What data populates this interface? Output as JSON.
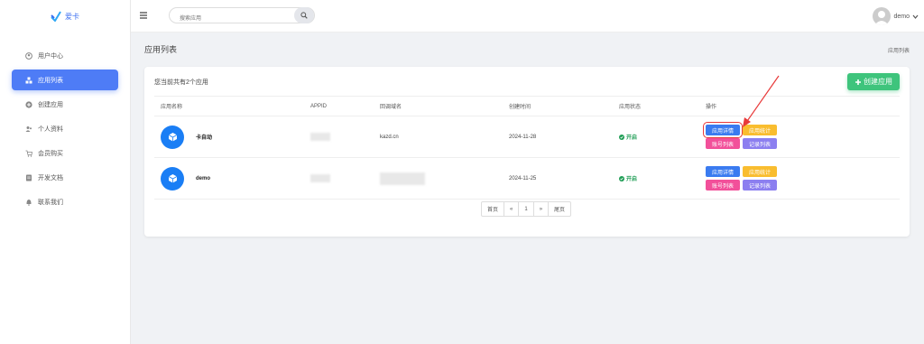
{
  "brand": {
    "name": "爱卡",
    "color": "#3b6ef0"
  },
  "sidebar": {
    "items": [
      {
        "label": "用户中心",
        "icon": "user-circle-icon",
        "active": false
      },
      {
        "label": "应用列表",
        "icon": "cubes-icon",
        "active": true
      },
      {
        "label": "创建应用",
        "icon": "plus-circle-icon",
        "active": false
      },
      {
        "label": "个人资料",
        "icon": "users-icon",
        "active": false
      },
      {
        "label": "会员购买",
        "icon": "cart-icon",
        "active": false
      },
      {
        "label": "开发文档",
        "icon": "document-icon",
        "active": false
      },
      {
        "label": "联系我们",
        "icon": "bell-icon",
        "active": false
      }
    ]
  },
  "topbar": {
    "search_placeholder": "搜索应用",
    "username": "demo"
  },
  "page": {
    "title": "应用列表",
    "breadcrumb": "应用列表"
  },
  "card": {
    "count_text": "您当前共有2个应用",
    "create_label": "创建应用"
  },
  "table": {
    "headers": [
      "应用名称",
      "APPID",
      "回调域名",
      "创建时间",
      "应用状态",
      "操作"
    ],
    "rows": [
      {
        "name": "卡自动",
        "appid": "",
        "domain": "kazd.cn",
        "created": "2024-11-28",
        "status": "开启"
      },
      {
        "name": "demo",
        "appid": "",
        "domain": "",
        "created": "2024-11-25",
        "status": "开启"
      }
    ],
    "ops": {
      "detail": "应用详情",
      "stats": "应用统计",
      "accounts": "账号列表",
      "records": "记录列表"
    }
  },
  "pager": {
    "first": "首页",
    "prev": "«",
    "current": "1",
    "next": "»",
    "last": "尾页"
  },
  "colors": {
    "accent": "#4e7cf6",
    "success": "#3ec47c",
    "status": "#1f9d55",
    "highlight": "#e83a3a"
  }
}
